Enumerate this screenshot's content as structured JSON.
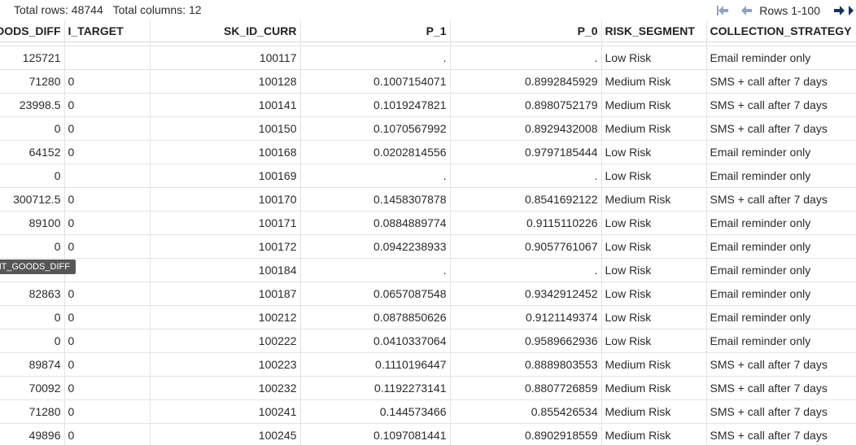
{
  "summary": {
    "total_rows": "Total rows: 48744",
    "total_columns": "Total columns: 12"
  },
  "pager": {
    "rows_label": "Rows 1-100"
  },
  "columns": [
    {
      "label": "AMT_CREDIT_MINUS_AMT_GOODS_DIFF",
      "align": "num"
    },
    {
      "label": "I_TARGET",
      "align": "txt"
    },
    {
      "label": "SK_ID_CURR",
      "align": "num"
    },
    {
      "label": "P_1",
      "align": "num"
    },
    {
      "label": "P_0",
      "align": "num"
    },
    {
      "label": "RISK_SEGMENT",
      "align": "txt"
    },
    {
      "label": "COLLECTION_STRATEGY",
      "align": "txt"
    }
  ],
  "rows": [
    [
      "125721",
      "",
      "100117",
      ".",
      ".",
      "Low Risk",
      "Email reminder only"
    ],
    [
      "71280",
      "0",
      "100128",
      "0.1007154071",
      "0.8992845929",
      "Medium Risk",
      "SMS + call after 7 days"
    ],
    [
      "23998.5",
      "0",
      "100141",
      "0.1019247821",
      "0.8980752179",
      "Medium Risk",
      "SMS + call after 7 days"
    ],
    [
      "0",
      "0",
      "100150",
      "0.1070567992",
      "0.8929432008",
      "Medium Risk",
      "SMS + call after 7 days"
    ],
    [
      "64152",
      "0",
      "100168",
      "0.0202814556",
      "0.9797185444",
      "Low Risk",
      "Email reminder only"
    ],
    [
      "0",
      "",
      "100169",
      ".",
      ".",
      "Low Risk",
      "Email reminder only"
    ],
    [
      "300712.5",
      "0",
      "100170",
      "0.1458307878",
      "0.8541692122",
      "Medium Risk",
      "SMS + call after 7 days"
    ],
    [
      "89100",
      "0",
      "100171",
      "0.0884889774",
      "0.9115110226",
      "Low Risk",
      "Email reminder only"
    ],
    [
      "0",
      "0",
      "100172",
      "0.0942238933",
      "0.9057761067",
      "Low Risk",
      "Email reminder only"
    ],
    [
      "",
      "",
      "100184",
      ".",
      ".",
      "Low Risk",
      "Email reminder only"
    ],
    [
      "82863",
      "0",
      "100187",
      "0.0657087548",
      "0.9342912452",
      "Low Risk",
      "Email reminder only"
    ],
    [
      "0",
      "0",
      "100212",
      "0.0878850626",
      "0.9121149374",
      "Low Risk",
      "Email reminder only"
    ],
    [
      "0",
      "0",
      "100222",
      "0.0410337064",
      "0.9589662936",
      "Low Risk",
      "Email reminder only"
    ],
    [
      "89874",
      "0",
      "100223",
      "0.1110196447",
      "0.8889803553",
      "Medium Risk",
      "SMS + call after 7 days"
    ],
    [
      "70092",
      "0",
      "100232",
      "0.1192273141",
      "0.8807726859",
      "Medium Risk",
      "SMS + call after 7 days"
    ],
    [
      "71280",
      "0",
      "100241",
      "0.144573466",
      "0.855426534",
      "Medium Risk",
      "SMS + call after 7 days"
    ],
    [
      "49896",
      "0",
      "100245",
      "0.1097081441",
      "0.8902918559",
      "Medium Risk",
      "SMS + call after 7 days"
    ]
  ],
  "tooltip": {
    "text": "AMT_CREDIT_MINUS_AMT_GOODS_DIFF"
  },
  "icons": {
    "first": "first-page-icon",
    "prev": "previous-page-icon",
    "next": "next-page-icon",
    "last": "last-page-icon"
  },
  "colors": {
    "icon_active": "#2b4a77",
    "icon_disabled": "#8fa3bf"
  }
}
